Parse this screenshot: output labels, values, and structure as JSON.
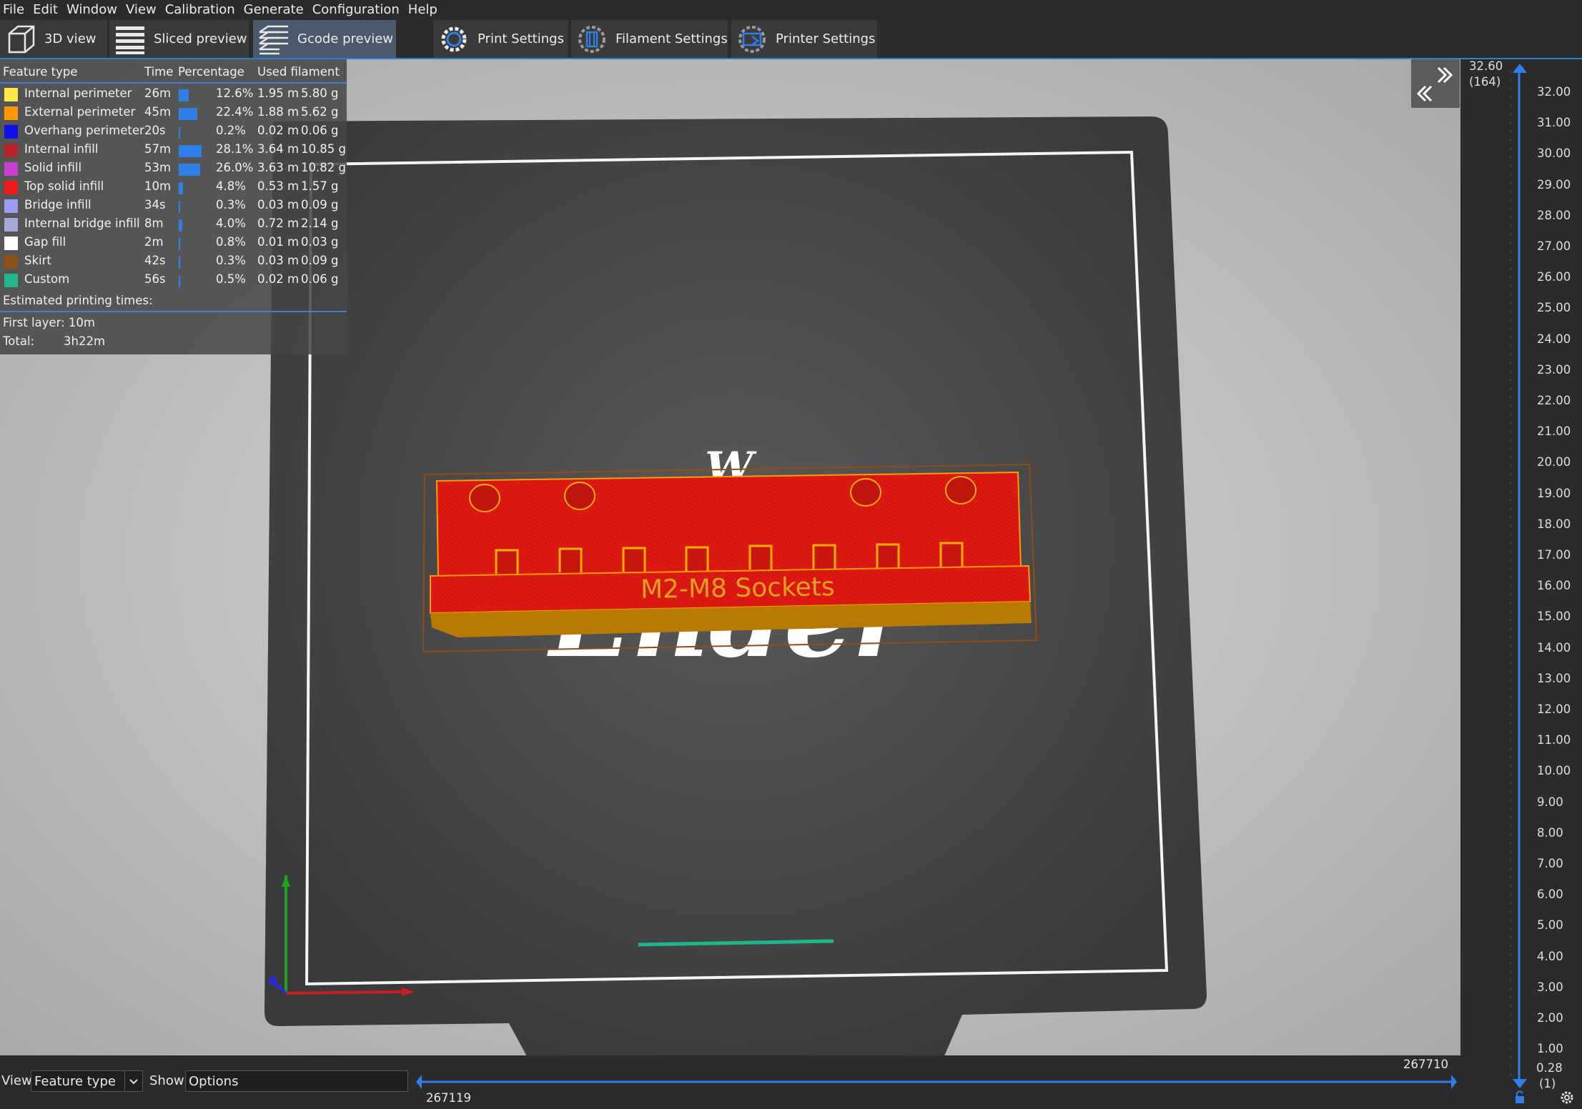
{
  "menu": [
    "File",
    "Edit",
    "Window",
    "View",
    "Calibration",
    "Generate",
    "Configuration",
    "Help"
  ],
  "tabs": [
    {
      "label": "3D view"
    },
    {
      "label": "Sliced preview"
    },
    {
      "label": "Gcode preview"
    },
    {
      "label": "Print Settings"
    },
    {
      "label": "Filament Settings"
    },
    {
      "label": "Printer Settings"
    }
  ],
  "colors": {
    "accent": "#2f7bd9",
    "plate": "#3f3f3f",
    "model_top": "#e01a12",
    "model_side": "#b87a00"
  },
  "legend": {
    "headers": {
      "feature": "Feature type",
      "time": "Time",
      "percentage": "Percentage",
      "used": "Used filament"
    },
    "rows": [
      {
        "name": "Internal perimeter",
        "color": "#ffe94a",
        "time": "26m",
        "percent": "12.6%",
        "pct": 12.6,
        "length": "1.95 m",
        "weight": "5.80 g"
      },
      {
        "name": "External perimeter",
        "color": "#ff9a00",
        "time": "45m",
        "percent": "22.4%",
        "pct": 22.4,
        "length": "1.88 m",
        "weight": "5.62 g"
      },
      {
        "name": "Overhang perimeter",
        "color": "#1010ee",
        "time": "20s",
        "percent": "0.2%",
        "pct": 0.2,
        "length": "0.02 m",
        "weight": "0.06 g"
      },
      {
        "name": "Internal infill",
        "color": "#b5262c",
        "time": "57m",
        "percent": "28.1%",
        "pct": 28.1,
        "length": "3.64 m",
        "weight": "10.85 g"
      },
      {
        "name": "Solid infill",
        "color": "#c93fd0",
        "time": "53m",
        "percent": "26.0%",
        "pct": 26.0,
        "length": "3.63 m",
        "weight": "10.82 g"
      },
      {
        "name": "Top solid infill",
        "color": "#f01a1a",
        "time": "10m",
        "percent": "4.8%",
        "pct": 4.8,
        "length": "0.53 m",
        "weight": "1.57 g"
      },
      {
        "name": "Bridge infill",
        "color": "#9c9cf2",
        "time": "34s",
        "percent": "0.3%",
        "pct": 0.3,
        "length": "0.03 m",
        "weight": "0.09 g"
      },
      {
        "name": "Internal bridge infill",
        "color": "#a8a8d8",
        "time": "8m",
        "percent": "4.0%",
        "pct": 4.0,
        "length": "0.72 m",
        "weight": "2.14 g"
      },
      {
        "name": "Gap fill",
        "color": "#ffffff",
        "time": "2m",
        "percent": "0.8%",
        "pct": 0.8,
        "length": "0.01 m",
        "weight": "0.03 g"
      },
      {
        "name": "Skirt",
        "color": "#8c4f18",
        "time": "42s",
        "percent": "0.3%",
        "pct": 0.3,
        "length": "0.03 m",
        "weight": "0.09 g"
      },
      {
        "name": "Custom",
        "color": "#21b58a",
        "time": "56s",
        "percent": "0.5%",
        "pct": 0.5,
        "length": "0.02 m",
        "weight": "0.06 g"
      }
    ],
    "estimated": "Estimated printing times:",
    "first_layer": "First layer: 10m",
    "total_label": "Total:",
    "total_value": "3h22m"
  },
  "model": {
    "label": "M2-M8 Sockets",
    "bed_logo": "Ender"
  },
  "vslider": {
    "top_value": "32.60",
    "top_layer": "(164)",
    "bottom_value": "0.28",
    "bottom_layer": "(1)",
    "ticks": [
      "32.00",
      "31.00",
      "30.00",
      "29.00",
      "28.00",
      "27.00",
      "26.00",
      "25.00",
      "24.00",
      "23.00",
      "22.00",
      "21.00",
      "20.00",
      "19.00",
      "18.00",
      "17.00",
      "16.00",
      "15.00",
      "14.00",
      "13.00",
      "12.00",
      "11.00",
      "10.00",
      "9.00",
      "8.00",
      "7.00",
      "6.00",
      "5.00",
      "4.00",
      "3.00",
      "2.00",
      "1.00"
    ]
  },
  "bottom": {
    "view_label": "View",
    "view_value": "Feature type",
    "show_label": "Show",
    "show_value": "Options",
    "hslider_right": "267710",
    "hslider_left": "267119"
  }
}
